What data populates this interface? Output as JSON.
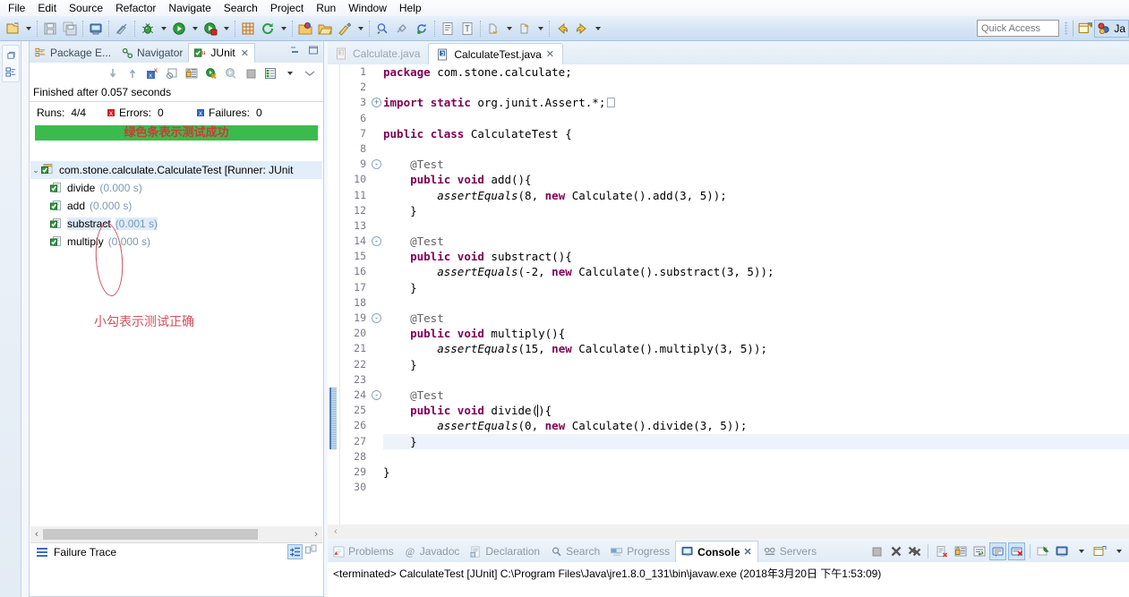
{
  "window": {
    "menu": [
      "File",
      "Edit",
      "Source",
      "Refactor",
      "Navigate",
      "Search",
      "Project",
      "Run",
      "Window",
      "Help"
    ],
    "quick_access": {
      "placeholder": "Quick Access",
      "value": ""
    },
    "perspective": {
      "label": "Ja",
      "name": "java-perspective"
    }
  },
  "toolbar": {
    "items": [
      {
        "name": "new-wizard-icon",
        "glyph": "new"
      },
      {
        "name": "new-dropdown-caret",
        "glyph": "caret"
      },
      {
        "name": "save-icon",
        "glyph": "save"
      },
      {
        "name": "save-all-icon",
        "glyph": "saveall"
      },
      {
        "name": "print-icon",
        "glyph": "print"
      },
      {
        "name": "toggle-mark-occurrences-icon",
        "glyph": "pen"
      },
      {
        "name": "debug-icon",
        "glyph": "bug"
      },
      {
        "name": "debug-dropdown-caret",
        "glyph": "caret"
      },
      {
        "name": "run-icon",
        "glyph": "run"
      },
      {
        "name": "run-dropdown-caret",
        "glyph": "caret"
      },
      {
        "name": "coverage-icon",
        "glyph": "coverage"
      },
      {
        "name": "coverage-dropdown-caret",
        "glyph": "caret"
      },
      {
        "name": "new-java-package-icon",
        "glyph": "pkg"
      },
      {
        "name": "external-tools-icon",
        "glyph": "ext"
      },
      {
        "name": "external-tools-dropdown-caret",
        "glyph": "caret"
      },
      {
        "name": "new-java-project-icon",
        "glyph": "proj"
      },
      {
        "name": "open-folder-icon",
        "glyph": "folder"
      },
      {
        "name": "new-class-icon",
        "glyph": "class"
      },
      {
        "name": "new-class-dropdown-caret",
        "glyph": "caret"
      },
      {
        "name": "search-icon",
        "glyph": "search"
      },
      {
        "name": "link-icon",
        "glyph": "link"
      },
      {
        "name": "refresh-icon",
        "glyph": "refresh"
      },
      {
        "name": "open-task-icon",
        "glyph": "task"
      },
      {
        "name": "open-type-icon",
        "glyph": "type"
      },
      {
        "name": "next-annotation-icon",
        "glyph": "nextanno"
      },
      {
        "name": "next-annotation-dropdown-caret",
        "glyph": "caret"
      },
      {
        "name": "previous-annotation-icon",
        "glyph": "prevanno"
      },
      {
        "name": "previous-annotation-dropdown-caret",
        "glyph": "caret"
      },
      {
        "name": "back-icon",
        "glyph": "back"
      },
      {
        "name": "forward-icon",
        "glyph": "forward"
      },
      {
        "name": "forward-dropdown-caret",
        "glyph": "caret"
      }
    ]
  },
  "junit_view": {
    "tabs": [
      {
        "label": "Package E...",
        "icon": "package-explorer-icon",
        "active": false
      },
      {
        "label": "Navigator",
        "icon": "navigator-icon",
        "active": false
      },
      {
        "label": "JUnit",
        "icon": "junit-icon",
        "active": true,
        "close": "✕"
      }
    ],
    "toolbar": [
      {
        "name": "next-failure-icon"
      },
      {
        "name": "previous-failure-icon"
      },
      {
        "name": "show-failures-only-icon"
      },
      {
        "name": "show-ignored-icon"
      },
      {
        "name": "scroll-lock-icon"
      },
      {
        "name": "rerun-test-icon"
      },
      {
        "name": "rerun-test-failures-icon"
      },
      {
        "name": "stop-icon"
      },
      {
        "name": "test-run-history-icon"
      },
      {
        "name": "view-menu-caret-icon"
      },
      {
        "name": "minimize-view-icon"
      }
    ],
    "status": "Finished after 0.057 seconds",
    "counters": {
      "runs_label": "Runs:",
      "runs_value": "4/4",
      "errors_label": "Errors:",
      "errors_value": "0",
      "failures_label": "Failures:",
      "failures_value": "0"
    },
    "progress_bar": {
      "color": "#3bbb4e",
      "percent": 100,
      "overlay_note": "绿色条表示测试成功"
    },
    "tree": {
      "root": {
        "label": "com.stone.calculate.CalculateTest [Runner: JUnit",
        "icon": "test-suite-pass-icon",
        "expander": "⌄"
      },
      "children": [
        {
          "label": "divide",
          "time": "(0.000 s)",
          "icon": "test-pass-icon",
          "selected": false
        },
        {
          "label": "add",
          "time": "(0.000 s)",
          "icon": "test-pass-icon",
          "selected": false
        },
        {
          "label": "substract",
          "time": "(0.001 s)",
          "icon": "test-pass-icon",
          "selected": true
        },
        {
          "label": "multiply",
          "time": "(0.000 s)",
          "icon": "test-pass-icon",
          "selected": false
        }
      ]
    },
    "annotation_note": "小勾表示测试正确",
    "failure_trace": {
      "label": "Failure Trace",
      "icon": "failure-trace-icon",
      "buttons": [
        {
          "name": "enable-stack-filter-icon"
        },
        {
          "name": "compare-result-icon"
        }
      ]
    },
    "scrollbar": {
      "left_arrow": "‹",
      "right_arrow": "›"
    }
  },
  "editor": {
    "tabs": [
      {
        "label": "Calculate.java",
        "icon": "java-file-icon",
        "active": false
      },
      {
        "label": "CalculateTest.java",
        "icon": "java-file-icon",
        "active": true,
        "close": "✕"
      }
    ],
    "current_line": 27,
    "changed_lines": [
      24,
      25,
      26,
      27
    ],
    "lines": [
      {
        "n": "1",
        "fold": "",
        "text": "package com.stone.calculate;",
        "tokens": [
          {
            "t": "package",
            "c": "kw"
          },
          {
            "t": " com.stone.calculate;",
            "c": ""
          }
        ]
      },
      {
        "n": "2",
        "fold": "",
        "text": "",
        "tokens": []
      },
      {
        "n": "3",
        "fold": "+",
        "text": "import static org.junit.Assert.*;",
        "tokens": [
          {
            "t": "import",
            "c": "kw"
          },
          {
            "t": " ",
            "c": ""
          },
          {
            "t": "static",
            "c": "kw"
          },
          {
            "t": " org.junit.Assert.*;",
            "c": ""
          },
          {
            "t": "⎕",
            "c": "fold-box"
          }
        ]
      },
      {
        "n": "6",
        "fold": "",
        "text": "",
        "tokens": []
      },
      {
        "n": "7",
        "fold": "",
        "text": "public class CalculateTest {",
        "tokens": [
          {
            "t": "public",
            "c": "kw"
          },
          {
            "t": " ",
            "c": ""
          },
          {
            "t": "class",
            "c": "kw"
          },
          {
            "t": " CalculateTest {",
            "c": ""
          }
        ]
      },
      {
        "n": "8",
        "fold": "",
        "text": "",
        "tokens": []
      },
      {
        "n": "9",
        "fold": "-",
        "text": "    @Test",
        "tokens": [
          {
            "t": "    @Test",
            "c": "an"
          }
        ]
      },
      {
        "n": "10",
        "fold": "",
        "text": "    public void add(){",
        "tokens": [
          {
            "t": "    ",
            "c": ""
          },
          {
            "t": "public",
            "c": "kw"
          },
          {
            "t": " ",
            "c": ""
          },
          {
            "t": "void",
            "c": "kw"
          },
          {
            "t": " add(){",
            "c": ""
          }
        ]
      },
      {
        "n": "11",
        "fold": "",
        "text": "        assertEquals(8, new Calculate().add(3, 5));",
        "tokens": [
          {
            "t": "        ",
            "c": ""
          },
          {
            "t": "assertEquals",
            "c": "it"
          },
          {
            "t": "(8, ",
            "c": ""
          },
          {
            "t": "new",
            "c": "kw"
          },
          {
            "t": " Calculate().add(3, 5));",
            "c": ""
          }
        ]
      },
      {
        "n": "12",
        "fold": "",
        "text": "    }",
        "tokens": [
          {
            "t": "    }",
            "c": ""
          }
        ]
      },
      {
        "n": "13",
        "fold": "",
        "text": "",
        "tokens": []
      },
      {
        "n": "14",
        "fold": "-",
        "text": "    @Test",
        "tokens": [
          {
            "t": "    @Test",
            "c": "an"
          }
        ]
      },
      {
        "n": "15",
        "fold": "",
        "text": "    public void substract(){",
        "tokens": [
          {
            "t": "    ",
            "c": ""
          },
          {
            "t": "public",
            "c": "kw"
          },
          {
            "t": " ",
            "c": ""
          },
          {
            "t": "void",
            "c": "kw"
          },
          {
            "t": " substract(){",
            "c": ""
          }
        ]
      },
      {
        "n": "16",
        "fold": "",
        "text": "        assertEquals(-2, new Calculate().substract(3, 5));",
        "tokens": [
          {
            "t": "        ",
            "c": ""
          },
          {
            "t": "assertEquals",
            "c": "it"
          },
          {
            "t": "(-2, ",
            "c": ""
          },
          {
            "t": "new",
            "c": "kw"
          },
          {
            "t": " Calculate().substract(3, 5));",
            "c": ""
          }
        ]
      },
      {
        "n": "17",
        "fold": "",
        "text": "    }",
        "tokens": [
          {
            "t": "    }",
            "c": ""
          }
        ]
      },
      {
        "n": "18",
        "fold": "",
        "text": "",
        "tokens": []
      },
      {
        "n": "19",
        "fold": "-",
        "text": "    @Test",
        "tokens": [
          {
            "t": "    @Test",
            "c": "an"
          }
        ]
      },
      {
        "n": "20",
        "fold": "",
        "text": "    public void multiply(){",
        "tokens": [
          {
            "t": "    ",
            "c": ""
          },
          {
            "t": "public",
            "c": "kw"
          },
          {
            "t": " ",
            "c": ""
          },
          {
            "t": "void",
            "c": "kw"
          },
          {
            "t": " multiply(){",
            "c": ""
          }
        ]
      },
      {
        "n": "21",
        "fold": "",
        "text": "        assertEquals(15, new Calculate().multiply(3, 5));",
        "tokens": [
          {
            "t": "        ",
            "c": ""
          },
          {
            "t": "assertEquals",
            "c": "it"
          },
          {
            "t": "(15, ",
            "c": ""
          },
          {
            "t": "new",
            "c": "kw"
          },
          {
            "t": " Calculate().multiply(3, 5));",
            "c": ""
          }
        ]
      },
      {
        "n": "22",
        "fold": "",
        "text": "    }",
        "tokens": [
          {
            "t": "    }",
            "c": ""
          }
        ]
      },
      {
        "n": "23",
        "fold": "",
        "text": "",
        "tokens": []
      },
      {
        "n": "24",
        "fold": "-",
        "text": "    @Test",
        "tokens": [
          {
            "t": "    @Test",
            "c": "an"
          }
        ]
      },
      {
        "n": "25",
        "fold": "",
        "text": "    public void divide(){",
        "tokens": [
          {
            "t": "    ",
            "c": ""
          },
          {
            "t": "public",
            "c": "kw"
          },
          {
            "t": " ",
            "c": ""
          },
          {
            "t": "void",
            "c": "kw"
          },
          {
            "t": " divide(){",
            "c": ""
          }
        ]
      },
      {
        "n": "26",
        "fold": "",
        "text": "        assertEquals(0, new Calculate().divide(3, 5));",
        "tokens": [
          {
            "t": "        ",
            "c": ""
          },
          {
            "t": "assertEquals",
            "c": "it"
          },
          {
            "t": "(0, ",
            "c": ""
          },
          {
            "t": "new",
            "c": "kw"
          },
          {
            "t": " Calculate().divide(3, 5));",
            "c": ""
          }
        ]
      },
      {
        "n": "27",
        "fold": "",
        "text": "    }",
        "tokens": [
          {
            "t": "    }",
            "c": ""
          }
        ]
      },
      {
        "n": "28",
        "fold": "",
        "text": "",
        "tokens": []
      },
      {
        "n": "29",
        "fold": "",
        "text": "}",
        "tokens": [
          {
            "t": "}",
            "c": ""
          }
        ]
      },
      {
        "n": "30",
        "fold": "",
        "text": "",
        "tokens": []
      }
    ],
    "hscroll": {
      "left_arrow": "‹"
    }
  },
  "console_panel": {
    "tabs": [
      {
        "label": "Problems",
        "icon": "problems-icon",
        "active": false
      },
      {
        "label": "Javadoc",
        "icon": "javadoc-icon",
        "active": false
      },
      {
        "label": "Declaration",
        "icon": "declaration-icon",
        "active": false
      },
      {
        "label": "Search",
        "icon": "search-icon",
        "active": false
      },
      {
        "label": "Progress",
        "icon": "progress-icon",
        "active": false
      },
      {
        "label": "Console",
        "icon": "console-icon",
        "active": true,
        "close": "✕"
      },
      {
        "label": "Servers",
        "icon": "servers-icon",
        "active": false
      }
    ],
    "tools": [
      {
        "name": "terminate-icon",
        "on": false
      },
      {
        "name": "remove-launch-icon",
        "on": false
      },
      {
        "name": "remove-all-terminated-icon",
        "on": false
      },
      {
        "name": "clear-console-icon",
        "on": false
      },
      {
        "name": "scroll-lock-icon",
        "on": false
      },
      {
        "name": "word-wrap-icon",
        "on": false
      },
      {
        "name": "show-console-on-output-icon",
        "on": true
      },
      {
        "name": "show-console-on-error-icon",
        "on": true
      },
      {
        "name": "pin-console-icon",
        "on": false
      },
      {
        "name": "display-selected-console-icon",
        "on": false
      },
      {
        "name": "display-console-dropdown-caret",
        "on": false
      },
      {
        "name": "open-console-icon",
        "on": false
      },
      {
        "name": "open-console-dropdown-caret",
        "on": false
      }
    ],
    "output": "<terminated> CalculateTest [JUnit] C:\\Program Files\\Java\\jre1.8.0_131\\bin\\javaw.exe (2018年3月20日 下午1:53:09)"
  }
}
